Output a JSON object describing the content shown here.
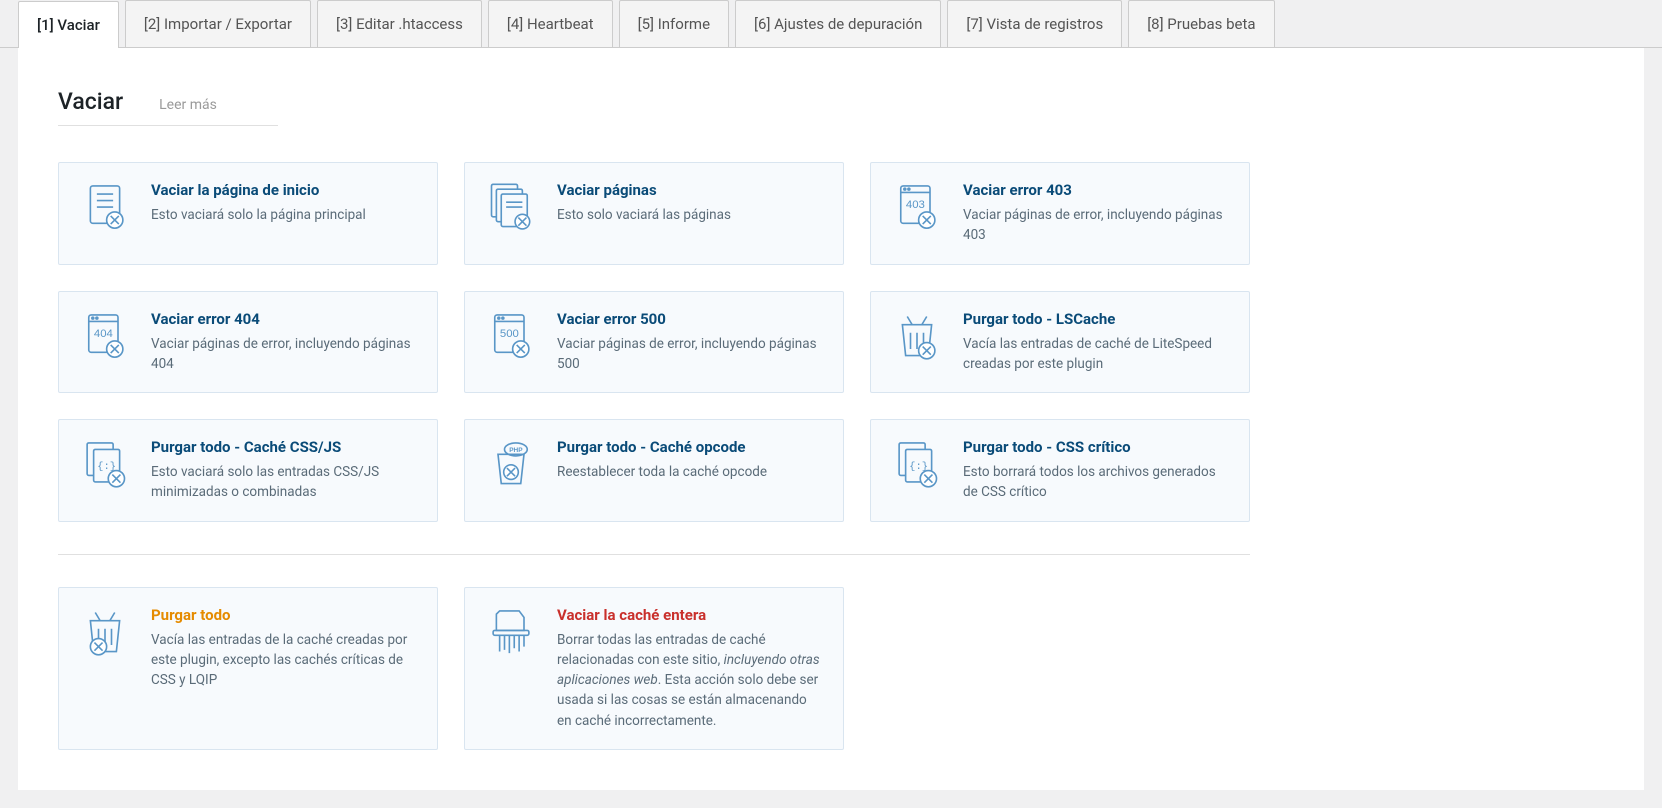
{
  "tabs": [
    {
      "label": "[1] Vaciar",
      "active": true
    },
    {
      "label": "[2] Importar / Exportar"
    },
    {
      "label": "[3] Editar .htaccess"
    },
    {
      "label": "[4] Heartbeat"
    },
    {
      "label": "[5] Informe"
    },
    {
      "label": "[6] Ajustes de depuración"
    },
    {
      "label": "[7] Vista de registros"
    },
    {
      "label": "[8] Pruebas beta"
    }
  ],
  "section": {
    "title": "Vaciar",
    "read_more": "Leer más"
  },
  "cards": [
    {
      "title": "Vaciar la página de inicio",
      "desc": "Esto vaciará solo la página principal",
      "icon": "doc-x"
    },
    {
      "title": "Vaciar páginas",
      "desc": "Esto solo vaciará las páginas",
      "icon": "docs-x"
    },
    {
      "title": "Vaciar error 403",
      "desc": "Vaciar páginas de error, incluyendo páginas 403",
      "icon": "doc-403"
    },
    {
      "title": "Vaciar error 404",
      "desc": "Vaciar páginas de error, incluyendo páginas 404",
      "icon": "doc-404"
    },
    {
      "title": "Vaciar error 500",
      "desc": "Vaciar páginas de error, incluyendo páginas 500",
      "icon": "doc-500"
    },
    {
      "title": "Purgar todo - LSCache",
      "desc": "Vacía las entradas de caché de LiteSpeed creadas por este plugin",
      "icon": "bin-ls"
    },
    {
      "title": "Purgar todo - Caché CSS/JS",
      "desc": "Esto vaciará solo las entradas CSS/JS minimizadas o combinadas",
      "icon": "docs-code"
    },
    {
      "title": "Purgar todo - Caché opcode",
      "desc": "Reestablecer toda la caché opcode",
      "icon": "bin-php"
    },
    {
      "title": "Purgar todo - CSS crítico",
      "desc": "Esto borrará todos los archivos generados de CSS crítico",
      "icon": "docs-code"
    }
  ],
  "danger_cards": [
    {
      "title": "Purgar todo",
      "desc": "Vacía las entradas de la caché creadas por este plugin, excepto las cachés críticas de CSS y LQIP",
      "icon": "bin-ls",
      "color": "orange"
    },
    {
      "title": "Vaciar la caché entera",
      "desc_html": "Borrar todas las entradas de caché relacionadas con este sitio, <em>incluyendo otras aplicaciones web</em>. Esta acción solo debe ser usada si las cosas se están almacenando en caché incorrectamente.",
      "icon": "shred",
      "color": "red"
    }
  ],
  "icon_text": {
    "403": "403",
    "404": "404",
    "500": "500",
    "php": "PHP",
    "code": "{:}"
  }
}
